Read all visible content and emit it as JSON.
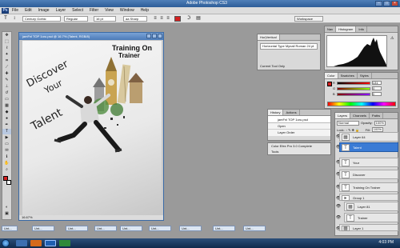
{
  "window": {
    "title": "Adobe Photoshop CS3"
  },
  "menu": {
    "logo": "Ps",
    "items": [
      "File",
      "Edit",
      "Image",
      "Layer",
      "Select",
      "Filter",
      "View",
      "Window",
      "Help"
    ]
  },
  "options": {
    "font_family": "Century Gothic",
    "font_style": "Regular",
    "font_size": "16 pt",
    "antialias": "aa  Sharp",
    "workspace": "Workspace"
  },
  "document": {
    "title": "jamFnl TOP 1oru.psd @ 16.7% (Talent, RGB/8)",
    "status": "16.67%",
    "text_discover": "Discover",
    "text_your": "Your",
    "text_talent": "Talent",
    "text_brand1": "Training On",
    "text_brand2": "Trainer"
  },
  "char_panel": {
    "tab": "Hor|Vertical",
    "item": "Horizontal Type Mynail Roman 24 pt",
    "footer": "Current Tool Only"
  },
  "navigator": {
    "tabs": [
      "Nav",
      "Histogram",
      "Info"
    ]
  },
  "color_panel": {
    "tabs": [
      "Color",
      "Swatches",
      "Styles"
    ],
    "rows": [
      {
        "label": "R",
        "value": "131"
      },
      {
        "label": "G",
        "value": "0"
      },
      {
        "label": "B",
        "value": "0"
      }
    ]
  },
  "history": {
    "tabs": [
      "History",
      "Actions"
    ],
    "doc": "jamFnl TOP 1oru.psd",
    "items": [
      "Open",
      "Layer Order"
    ]
  },
  "plugins": {
    "items": [
      "Color Efex Pro 3.0 Complete",
      "Tools"
    ]
  },
  "layers": {
    "tabs": [
      "Layers",
      "Channels",
      "Paths"
    ],
    "blend": "Normal",
    "opacity_label": "Opacity:",
    "opacity": "100%",
    "lock_label": "Lock:",
    "fill_label": "Fill:",
    "fill": "100%",
    "rows": [
      "Layer 64",
      "Talent",
      "Your",
      "Discover",
      "Training On Trainer",
      "Group 1",
      "Layer 81",
      "Trainer",
      "Layer 1"
    ]
  },
  "minidocs": [
    "Unt...",
    "Unt...",
    "Unt...",
    "Unt...",
    "Unt...",
    "Unt...",
    "Unt...",
    "Unt...",
    "Unt..."
  ],
  "taskbar": {
    "time": "4:03 PM"
  },
  "colors": {
    "accent": "#3a7bd5",
    "foreground": "#d42020",
    "background": "#ffffff"
  }
}
